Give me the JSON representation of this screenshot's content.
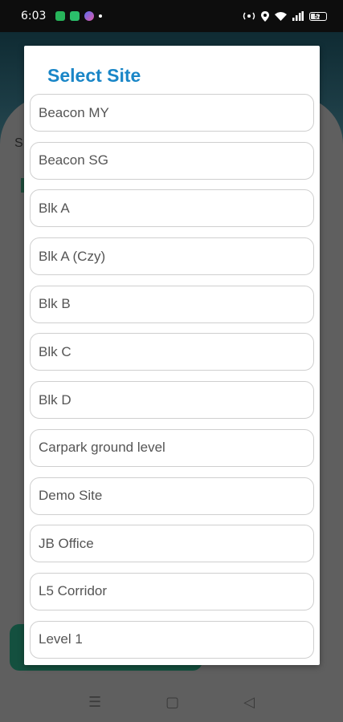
{
  "status_bar": {
    "time": "6:03",
    "battery_level": "57",
    "icons": [
      "app-notification-icon",
      "message-icon",
      "assistant-icon",
      "hotspot-icon",
      "location-icon",
      "wifi-icon",
      "signal-icon",
      "battery-icon"
    ]
  },
  "background": {
    "partial_text": "S"
  },
  "dialog": {
    "title": "Select Site",
    "title_color": "#1a86c7",
    "sites": [
      "Beacon MY",
      "Beacon SG",
      "Blk A",
      "Blk A (Czy)",
      "Blk B",
      "Blk C",
      "Blk D",
      "Carpark ground level",
      "Demo Site",
      "JB Office",
      "L5 Corridor",
      "Level 1"
    ]
  },
  "nav_bar": {
    "icons": [
      "menu-icon",
      "home-icon",
      "back-icon"
    ]
  }
}
